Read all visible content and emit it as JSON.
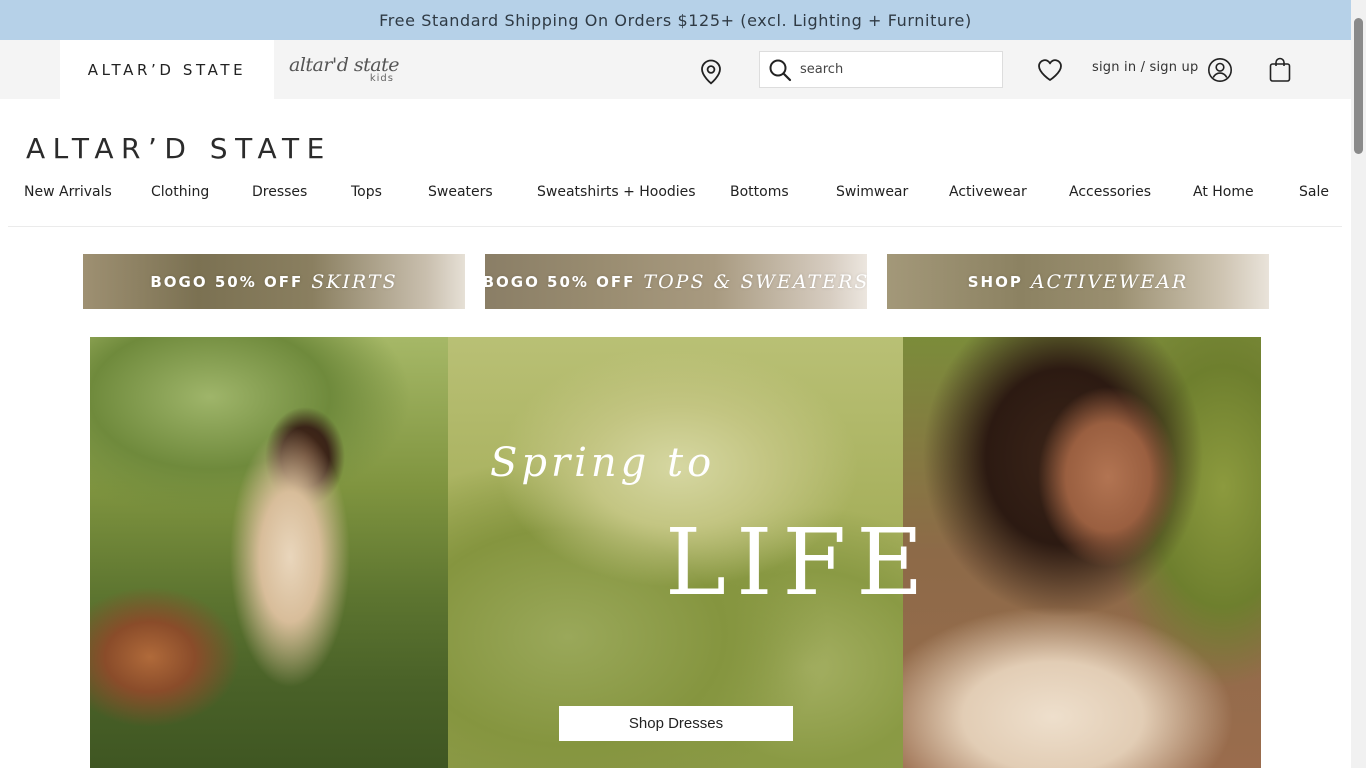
{
  "promo_bar": {
    "text": "Free Standard Shipping On Orders $125+ (excl. Lighting + Furniture)"
  },
  "utility_bar": {
    "brand_tabs": [
      {
        "label": "ALTAR’D STATE"
      },
      {
        "label": "altar'd state",
        "sub": "kids"
      }
    ],
    "search": {
      "placeholder": "search",
      "value": ""
    },
    "signin_label": "sign in / sign up",
    "icons": [
      "location-icon",
      "search-icon",
      "heart-icon",
      "account-icon",
      "bag-icon"
    ]
  },
  "header": {
    "logo": "ALTAR’D STATE"
  },
  "nav": {
    "items": [
      "New Arrivals",
      "Clothing",
      "Dresses",
      "Tops",
      "Sweaters",
      "Sweatshirts + Hoodies",
      "Bottoms",
      "Swimwear",
      "Activewear",
      "Accessories",
      "At Home",
      "Sale"
    ]
  },
  "promo_tiles": [
    {
      "prefix": "BOGO 50% OFF",
      "script": "SKIRTS"
    },
    {
      "prefix": "BOGO 50% OFF",
      "script": "TOPS & SWEATERS"
    },
    {
      "prefix": "SHOP",
      "script": "ACTIVEWEAR"
    }
  ],
  "hero": {
    "title_line1": "Spring to",
    "title_line2": "LIFE",
    "cta_label": "Shop Dresses"
  },
  "colors": {
    "promo_bar_bg": "#b6d1e8",
    "utility_bar_bg": "#f4f4f4",
    "text_dark": "#222222"
  }
}
